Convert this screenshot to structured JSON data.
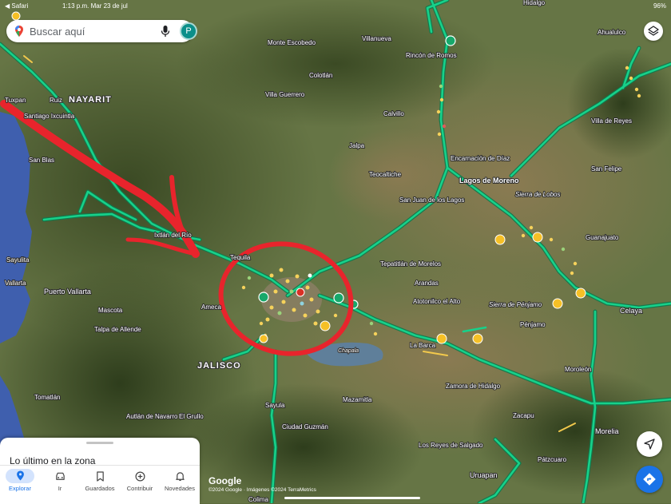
{
  "status_bar": {
    "back_app": "◀ Safari",
    "time_date": "1:13 p.m.  Mar 23 de jul",
    "battery": "96%"
  },
  "search": {
    "placeholder": "Buscar aquí",
    "avatar_letter": "P"
  },
  "map": {
    "state_labels": [
      "NAYARIT",
      "JALISCO"
    ],
    "places": [
      "Hidalgo",
      "Ahualulco",
      "Monte Escobedo",
      "Villanueva",
      "Rincón de Romos",
      "Colotlán",
      "Ruiz",
      "Santiago Ixcuintla",
      "Tuxpan",
      "Villa Guerrero",
      "Calvillo",
      "Villa de Reyes",
      "San Blas",
      "Jalpa",
      "Encarnación de Díaz",
      "Teocaltiche",
      "San Felipe",
      "Lagos de Moreno",
      "Sierra de Lobos",
      "San Juan de los Lagos",
      "Ixtlán del Río",
      "Guanajuato",
      "Sayulita",
      "Tequila",
      "Tepatitlán de Morelos",
      "Vallarta",
      "Puerto Vallarta",
      "Arandas",
      "Sierra de Pénjamo",
      "Ameca",
      "Atotonilco el Alto",
      "Celaya",
      "Mascota",
      "Talpa de Allende",
      "Pénjamo",
      "La Barca",
      "Chapala",
      "Moroleón",
      "Zamora de Hidalgo",
      "Tomatlán",
      "Mazamitla",
      "Sayula",
      "Autlán de Navarro",
      "El Grullo",
      "Zacapu",
      "Ciudad Guzmán",
      "Morelia",
      "Los Reyes de Salgado",
      "Pátzcuaro",
      "Uruapan",
      "Colima"
    ],
    "annotation_color": "#e8242c",
    "highway_color": "#17d18a",
    "water_color": "#3f5fae"
  },
  "bottom_sheet": {
    "title": "Lo último en la zona"
  },
  "nav": [
    {
      "label": "Explorar",
      "icon": "location-pin-icon"
    },
    {
      "label": "Ir",
      "icon": "car-icon"
    },
    {
      "label": "Guardados",
      "icon": "bookmark-icon"
    },
    {
      "label": "Contribuir",
      "icon": "add-circle-icon"
    },
    {
      "label": "Novedades",
      "icon": "bell-icon"
    }
  ],
  "attribution": {
    "logo": "Google",
    "text": "©2024 Google · Imágenes ©2024 TerraMetrics"
  },
  "accent_color": "#1a73e8"
}
